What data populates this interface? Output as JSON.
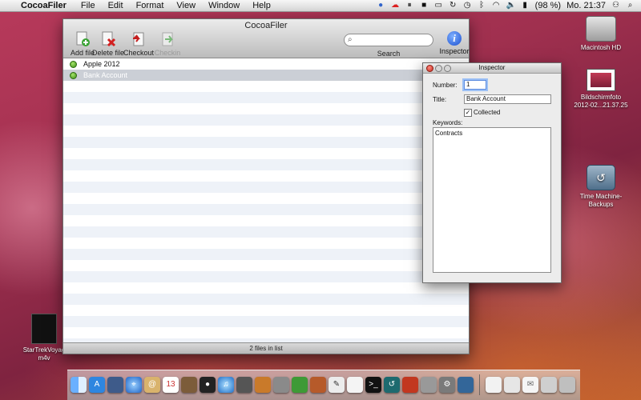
{
  "menubar": {
    "apple_symbol": "",
    "app_name": "CocoaFiler",
    "menus": [
      "File",
      "Edit",
      "Format",
      "View",
      "Window",
      "Help"
    ],
    "battery": "(98 %)",
    "clock": "Mo. 21:37"
  },
  "main_window": {
    "title": "CocoaFiler",
    "toolbar": {
      "add_file": "Add file",
      "delete_file": "Delete file",
      "checkout": "Checkout",
      "checkin": "Checkin",
      "search": "Search",
      "inspector": "Inspector"
    },
    "files": [
      {
        "name": "Apple 2012",
        "selected": false
      },
      {
        "name": "Bank Account",
        "selected": true
      }
    ],
    "status": "2 files in list"
  },
  "inspector": {
    "title": "Inspector",
    "number_label": "Number:",
    "number_value": "1",
    "title_label": "Title:",
    "title_value": "Bank Account",
    "collected_label": "Collected",
    "collected_checked": true,
    "keywords_label": "Keywords:",
    "keywords_value": "Contracts"
  },
  "desktop": {
    "hd_label": "Macintosh HD",
    "screenshot_label_1": "Bildschirmfoto",
    "screenshot_label_2": "2012-02...21.37.25",
    "timemachine_label_1": "Time Machine-",
    "timemachine_label_2": "Backups",
    "movie_label_1": "StarTrekVoyag",
    "movie_label_2": "m4v"
  },
  "colors": {
    "selection": "#cbcfd6",
    "status_dot": "#3d8e16",
    "inspector_icon": "#1b4fd0"
  }
}
